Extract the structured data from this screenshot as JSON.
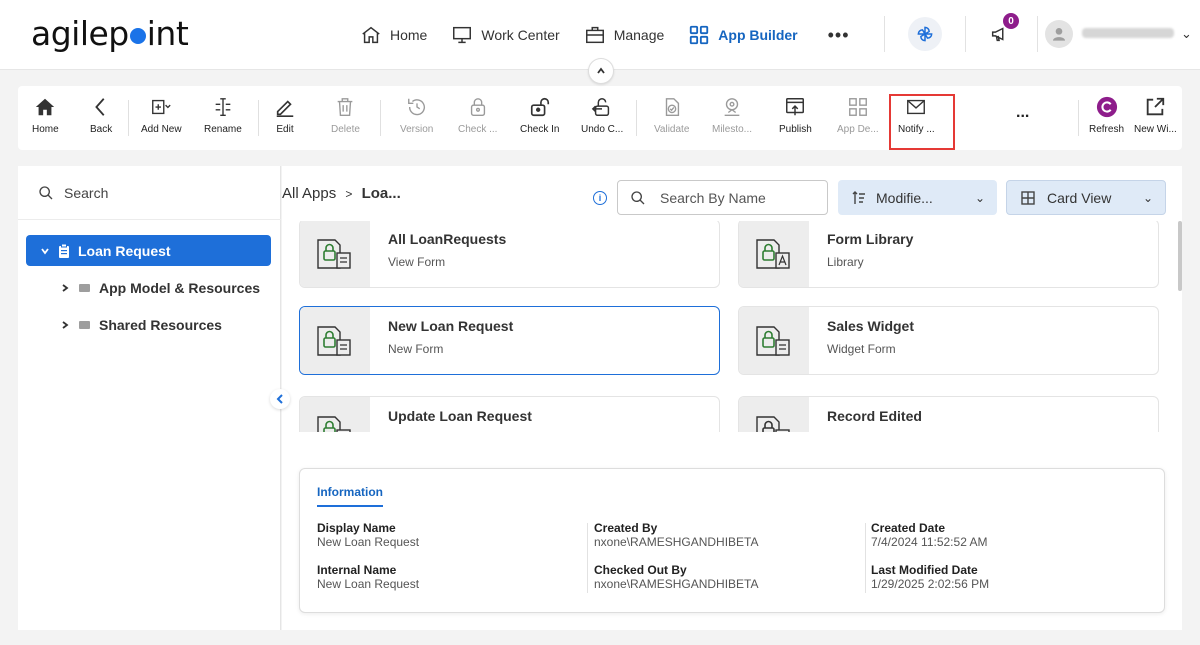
{
  "header": {
    "logo": "agilepoint",
    "nav": [
      {
        "label": "Home",
        "icon": "home-icon"
      },
      {
        "label": "Work Center",
        "icon": "monitor-icon"
      },
      {
        "label": "Manage",
        "icon": "briefcase-icon"
      },
      {
        "label": "App Builder",
        "icon": "grid-icon",
        "active": true
      }
    ],
    "more": "•••",
    "notification_count": "0"
  },
  "toolbar": [
    {
      "label": "Home",
      "icon": "home-icon"
    },
    {
      "label": "Back",
      "icon": "back-icon"
    },
    {
      "label": "Add New",
      "icon": "add-new-icon"
    },
    {
      "label": "Rename",
      "icon": "rename-icon"
    },
    {
      "label": "Edit",
      "icon": "edit-icon"
    },
    {
      "label": "Delete",
      "icon": "delete-icon",
      "disabled": true
    },
    {
      "label": "Version",
      "icon": "version-icon",
      "disabled": true
    },
    {
      "label": "Check ...",
      "icon": "check-out-icon",
      "disabled": true
    },
    {
      "label": "Check In",
      "icon": "check-in-icon"
    },
    {
      "label": "Undo C...",
      "icon": "undo-checkout-icon"
    },
    {
      "label": "Validate",
      "icon": "validate-icon",
      "disabled": true
    },
    {
      "label": "Milesto...",
      "icon": "milestone-icon",
      "disabled": true
    },
    {
      "label": "Publish",
      "icon": "publish-icon"
    },
    {
      "label": "App De...",
      "icon": "app-details-icon",
      "disabled": true
    },
    {
      "label": "Notify ...",
      "icon": "mail-icon"
    },
    {
      "label": "...",
      "icon": "more-icon"
    },
    {
      "label": "Refresh",
      "icon": "refresh-icon"
    },
    {
      "label": "New Wi...",
      "icon": "new-window-icon"
    }
  ],
  "sidebar": {
    "search_label": "Search",
    "tree": {
      "root": "Loan Request",
      "children": [
        "App Model & Resources",
        "Shared Resources"
      ]
    }
  },
  "main": {
    "breadcrumb_root": "All Apps",
    "breadcrumb_sep": ">",
    "breadcrumb_current": "Loa...",
    "search_placeholder": "Search By Name",
    "sort_label": "Modifie...",
    "view_label": "Card View",
    "cards": [
      {
        "title": "All LoanRequests",
        "subtitle": "View Form",
        "icon": "form-lock-icon"
      },
      {
        "title": "Form Library",
        "subtitle": "Library",
        "icon": "library-lock-icon"
      },
      {
        "title": "New Loan Request",
        "subtitle": "New Form",
        "icon": "form-lock-icon",
        "selected": true
      },
      {
        "title": "Sales Widget",
        "subtitle": "Widget Form",
        "icon": "form-lock-icon"
      },
      {
        "title": "Update Loan Request",
        "subtitle": "",
        "icon": "form-lock-icon"
      },
      {
        "title": "Record Edited",
        "subtitle": "",
        "icon": "form-lock-icon"
      }
    ]
  },
  "info": {
    "tab": "Information",
    "fields": [
      {
        "label": "Display Name",
        "value": "New Loan Request"
      },
      {
        "label": "Internal Name",
        "value": "New Loan Request"
      },
      {
        "label": "Created By",
        "value": "nxone\\RAMESHGANDHIBETA"
      },
      {
        "label": "Checked Out By",
        "value": "nxone\\RAMESHGANDHIBETA"
      },
      {
        "label": "Created Date",
        "value": "7/4/2024 11:52:52 AM"
      },
      {
        "label": "Last Modified Date",
        "value": "1/29/2025 2:02:56 PM"
      }
    ]
  },
  "colors": {
    "accent": "#1e6fd9",
    "highlight": "#e53935",
    "badge": "#8e1d8b",
    "lock_green": "#2e7d32"
  }
}
